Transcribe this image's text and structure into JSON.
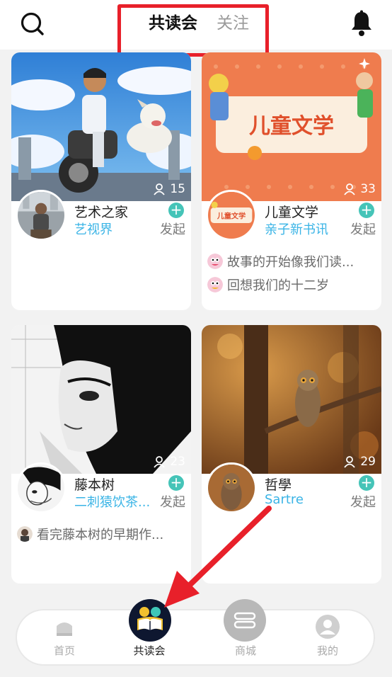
{
  "header": {
    "tabs": [
      {
        "label": "共读会",
        "active": true
      },
      {
        "label": "关注",
        "active": false
      }
    ],
    "accent_color": "#4fc8c3",
    "highlight_box_color": "#e8202a"
  },
  "cards": [
    {
      "title": "艺术之家",
      "subtitle": "艺视界",
      "members": "15",
      "action": "发起",
      "posts": []
    },
    {
      "title": "儿童文学",
      "subtitle": "亲子新书讯",
      "members": "33",
      "action": "发起",
      "cover_text": "儿童文学",
      "avatar_text": "儿童文学",
      "posts": [
        "故事的开始像我们读...",
        "回想我们的十二岁"
      ]
    },
    {
      "title": "藤本树",
      "subtitle": "二刺猿饮茶...",
      "members": "23",
      "action": "发起",
      "posts": [
        "看完藤本树的早期作..."
      ]
    },
    {
      "title": "哲學",
      "subtitle": "Sartre",
      "members": "29",
      "action": "发起",
      "posts": []
    }
  ],
  "bottom_nav": [
    {
      "label": "首页",
      "icon": "home-icon",
      "active": false
    },
    {
      "label": "共读会",
      "icon": "reading-group-icon",
      "active": true
    },
    {
      "label": "商城",
      "icon": "store-icon",
      "active": false
    },
    {
      "label": "我的",
      "icon": "profile-icon",
      "active": false
    }
  ],
  "annotation_arrow_color": "#e8202a"
}
